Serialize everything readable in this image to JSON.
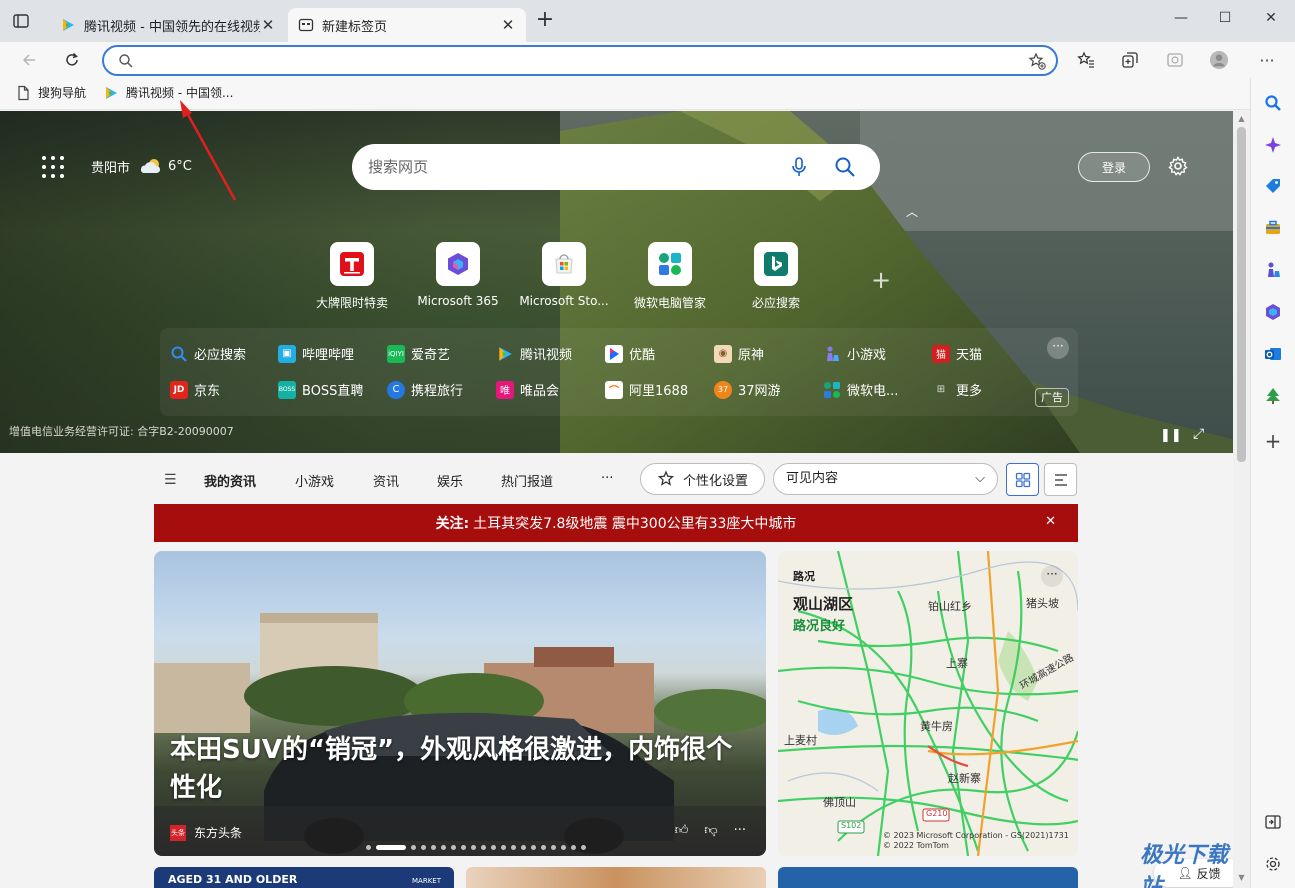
{
  "tabs": [
    {
      "title": "腾讯视频 - 中国领先的在线视频",
      "active": false
    },
    {
      "title": "新建标签页",
      "active": true
    }
  ],
  "window": {
    "minimize": "—",
    "maximize": "☐",
    "close": "✕"
  },
  "toolbar": {
    "address_value": "",
    "address_placeholder": ""
  },
  "favorites": [
    {
      "label": "搜狗导航",
      "icon": "page-icon"
    },
    {
      "label": "腾讯视频 - 中国领...",
      "icon": "tencent-video-icon"
    }
  ],
  "hero": {
    "city": "贵阳市",
    "temperature": "6°C",
    "search_placeholder": "搜索网页",
    "login_label": "登录",
    "license": "增值电信业务经营许可证: 合字B2-20090007"
  },
  "quick_links": [
    {
      "label": "大牌限时特卖",
      "icon": "t-brand-icon",
      "color": "#e0101b"
    },
    {
      "label": "Microsoft 365",
      "icon": "m365-icon",
      "color": "#6b4fd8"
    },
    {
      "label": "Microsoft Sto...",
      "icon": "store-icon",
      "color": "#f25022"
    },
    {
      "label": "微软电脑管家",
      "icon": "pc-manager-icon",
      "color": "#1aa37a"
    },
    {
      "label": "必应搜索",
      "icon": "bing-icon",
      "color": "#107c6c"
    }
  ],
  "site_links": [
    [
      {
        "label": "必应搜索",
        "color": "#1e88e5",
        "glyph": "🔍"
      },
      {
        "label": "哔哩哔哩",
        "color": "#23ade5",
        "glyph": "b"
      },
      {
        "label": "爱奇艺",
        "color": "#19b955",
        "glyph": "iq"
      },
      {
        "label": "腾讯视频",
        "color": "#20a0ff",
        "glyph": "▶"
      },
      {
        "label": "优酷",
        "color": "#1e6fff",
        "glyph": "▶"
      },
      {
        "label": "原神",
        "color": "#c08a5b",
        "glyph": "原"
      },
      {
        "label": "小游戏",
        "color": "#6b5bd6",
        "glyph": "♟"
      },
      {
        "label": "天猫",
        "color": "#d21f1f",
        "glyph": "猫"
      }
    ],
    [
      {
        "label": "京东",
        "color": "#e1251b",
        "glyph": "JD"
      },
      {
        "label": "BOSS直聘",
        "color": "#15b1a3",
        "glyph": "B"
      },
      {
        "label": "携程旅行",
        "color": "#2577e3",
        "glyph": "C"
      },
      {
        "label": "唯品会",
        "color": "#e6177a",
        "glyph": "唯"
      },
      {
        "label": "阿里1688",
        "color": "#ff6a00",
        "glyph": "⌒"
      },
      {
        "label": "37网游",
        "color": "#f0861a",
        "glyph": "37"
      },
      {
        "label": "微软电...",
        "color": "#1aa37a",
        "glyph": "✿"
      },
      {
        "label": "更多",
        "color": "#666666",
        "glyph": "⊞"
      }
    ]
  ],
  "ad_label": "广告",
  "feed_nav": {
    "items": [
      "我的资讯",
      "小游戏",
      "资讯",
      "娱乐",
      "热门报道",
      "···"
    ],
    "personalize": "个性化设置",
    "visible_content": "可见内容"
  },
  "alert": {
    "prefix": "关注:",
    "text": "土耳其突发7.8级地震 震中300公里有33座大中城市"
  },
  "hero_card": {
    "title": "本田SUV的“销冠”，外观风格很激进，内饰很个性化",
    "source": "东方头条",
    "source_logo": "头条"
  },
  "traffic_card": {
    "label": "路况",
    "area": "观山湖区",
    "status": "路况良好",
    "places": [
      "铂山红乡",
      "猪头坡",
      "上寨",
      "黄牛房",
      "上麦村",
      "佛顶山",
      "赵新寨",
      "环城高速公路",
      "G210",
      "S102"
    ],
    "copyright": "© 2023 Microsoft Corporation - GS(2021)1731\n© 2022 TomTom"
  },
  "bottom_card": {
    "text": "AGED 31 AND OLDER",
    "tag": "MARKET"
  },
  "feedback": "反馈",
  "watermark": "极光下载站"
}
